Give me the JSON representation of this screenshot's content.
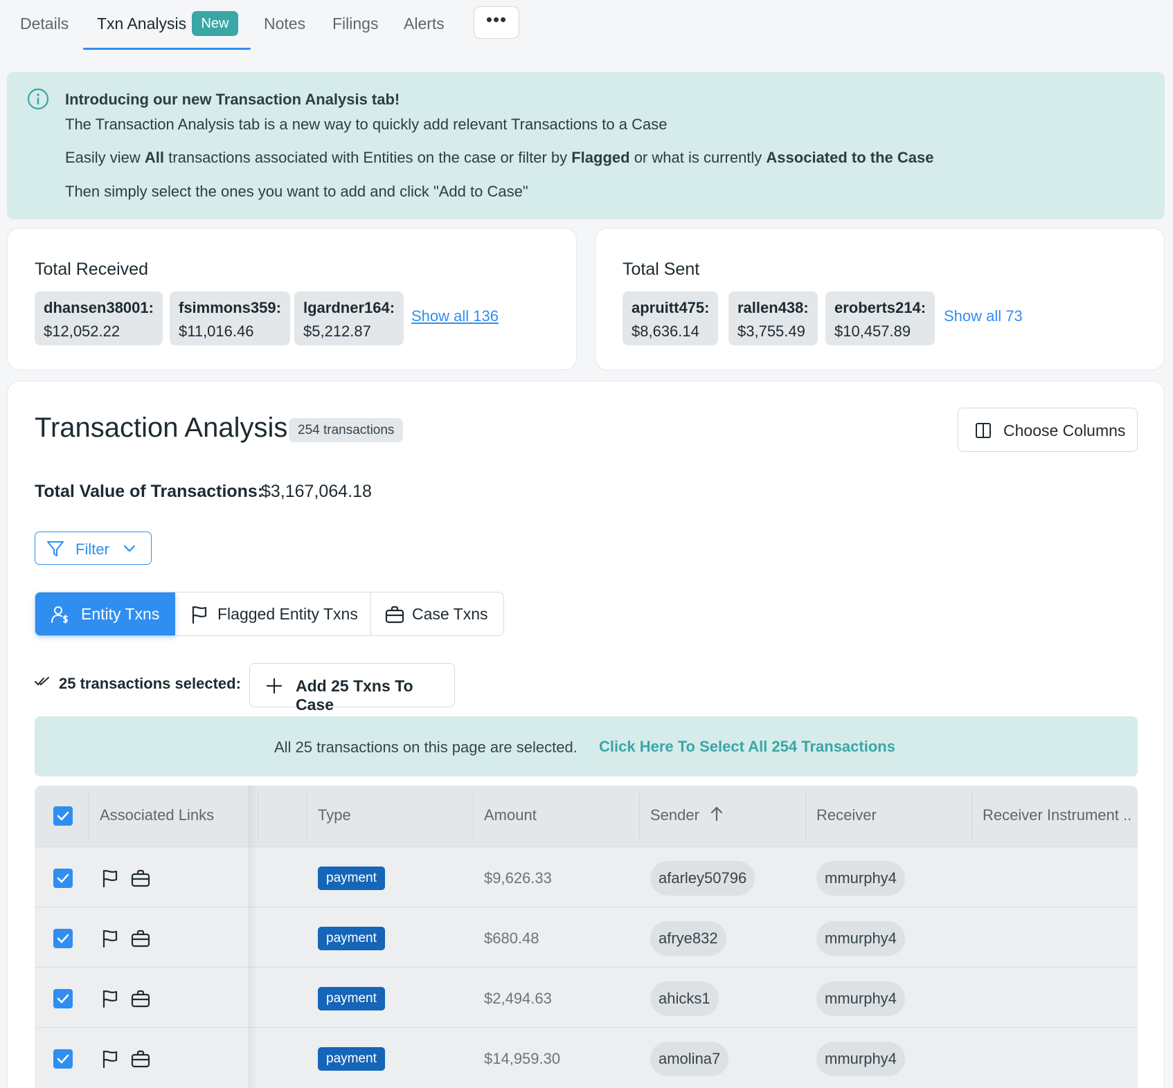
{
  "tabs": [
    {
      "label": "Details"
    },
    {
      "label": "Txn Analysis",
      "badge": "New",
      "active": true
    },
    {
      "label": "Notes"
    },
    {
      "label": "Filings"
    },
    {
      "label": "Alerts"
    }
  ],
  "more_label": "•••",
  "banner": {
    "title": "Introducing our new Transaction Analysis tab!",
    "line1": "The Transaction Analysis tab is a new way to quickly add relevant Transactions to a Case",
    "line2_a": "Easily view ",
    "line2_b": "All",
    "line2_c": " transactions associated with Entities on the case or filter by ",
    "line2_d": "Flagged",
    "line2_e": " or what is currently ",
    "line2_f": "Associated to the Case",
    "line3": "Then simply select the ones you want to add and click \"Add to Case\""
  },
  "received": {
    "title": "Total Received",
    "chips": [
      {
        "name": "dhansen38001:",
        "value": "$12,052.22"
      },
      {
        "name": "fsimmons359:",
        "value": "$11,016.46"
      },
      {
        "name": "lgardner164:",
        "value": "$5,212.87"
      }
    ],
    "show_all": "Show all 136"
  },
  "sent": {
    "title": "Total Sent",
    "chips": [
      {
        "name": "apruitt475:",
        "value": "$8,636.14"
      },
      {
        "name": "rallen438:",
        "value": "$3,755.49"
      },
      {
        "name": "eroberts214:",
        "value": "$10,457.89"
      }
    ],
    "show_all": "Show all 73"
  },
  "analysis": {
    "title": "Transaction Analysis",
    "count_badge": "254 transactions",
    "choose_columns": "Choose Columns",
    "total_label": "Total Value of Transactions:",
    "total_value": "$3,167,064.18",
    "filter_label": "Filter",
    "segments": {
      "entity": "Entity Txns",
      "flagged": "Flagged Entity Txns",
      "case": "Case Txns"
    },
    "selected_text": "25 transactions selected:",
    "add_button": "Add 25 Txns To Case",
    "selection_banner": {
      "text": "All 25 transactions on this page are selected.",
      "link": "Click Here To Select All 254 Transactions"
    }
  },
  "table": {
    "columns": [
      "Associated Links",
      "Type",
      "Amount",
      "Sender",
      "Receiver",
      "Receiver Instrument .."
    ],
    "rows": [
      {
        "type": "payment",
        "amount": "$9,626.33",
        "sender": "afarley50796",
        "receiver": "mmurphy4"
      },
      {
        "type": "payment",
        "amount": "$680.48",
        "sender": "afrye832",
        "receiver": "mmurphy4"
      },
      {
        "type": "payment",
        "amount": "$2,494.63",
        "sender": "ahicks1",
        "receiver": "mmurphy4"
      },
      {
        "type": "payment",
        "amount": "$14,959.30",
        "sender": "amolina7",
        "receiver": "mmurphy4"
      }
    ]
  },
  "colors": {
    "accent": "#2f8ef0",
    "teal": "#3aa6a6",
    "banner_bg": "#d5ecea",
    "type_tag": "#1565b8"
  }
}
